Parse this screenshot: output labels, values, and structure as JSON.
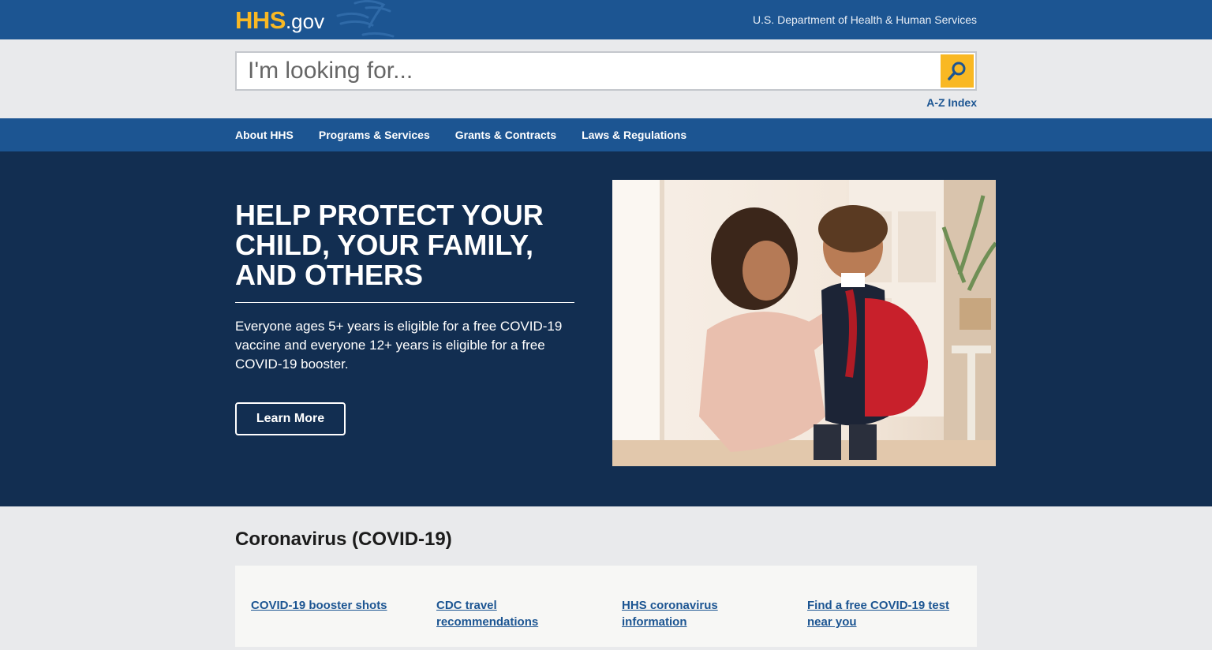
{
  "header": {
    "logo_hhs": "HHS",
    "logo_gov": ".gov",
    "department": "U.S. Department of Health & Human Services"
  },
  "search": {
    "placeholder": "I'm looking for...",
    "value": "",
    "button_icon": "search-icon",
    "az_index": "A-Z Index"
  },
  "nav": {
    "items": [
      {
        "label": "About HHS"
      },
      {
        "label": "Programs & Services"
      },
      {
        "label": "Grants & Contracts"
      },
      {
        "label": "Laws & Regulations"
      }
    ]
  },
  "hero": {
    "title": "HELP PROTECT YOUR CHILD, YOUR FAMILY, AND OTHERS",
    "text": "Everyone ages 5+ years is eligible for a free COVID-19 vaccine and everyone 12+ years is eligible for a free COVID-19 booster.",
    "button": "Learn More"
  },
  "covid": {
    "title": "Coronavirus (COVID-19)",
    "links": [
      {
        "label": "COVID-19 booster shots"
      },
      {
        "label": "CDC travel recommendations"
      },
      {
        "label": "HHS coronavirus information"
      },
      {
        "label": "Find a free COVID-19 test near you"
      }
    ]
  },
  "colors": {
    "header_blue": "#1c5592",
    "hero_navy": "#122e51",
    "accent_gold": "#f9b823",
    "band_gray": "#e9eaec"
  }
}
